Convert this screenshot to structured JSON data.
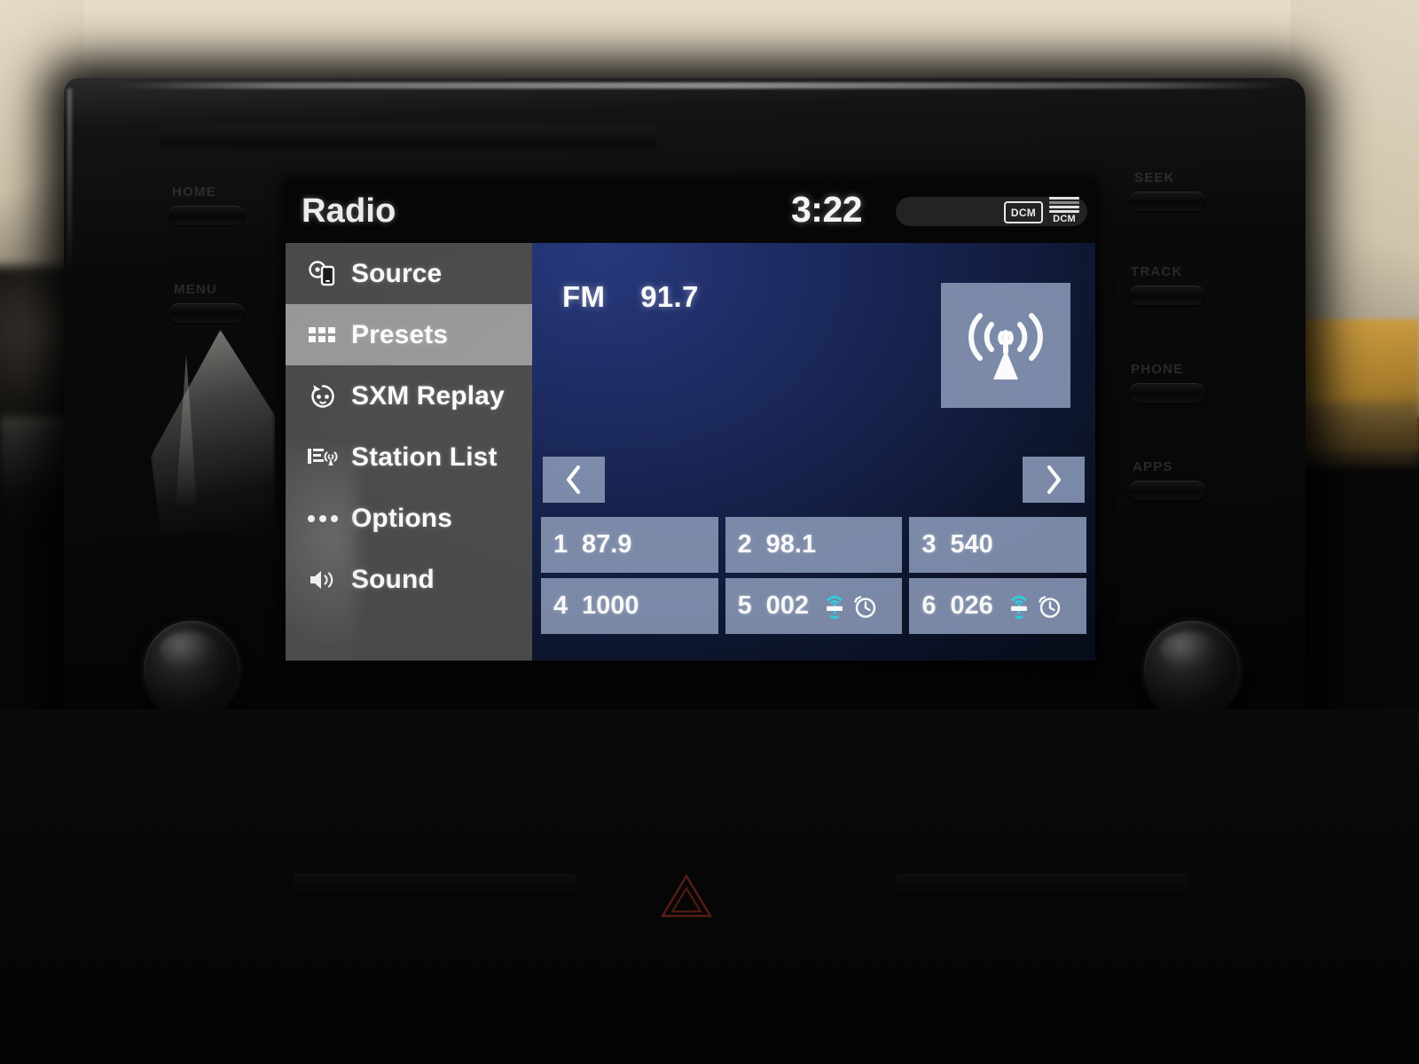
{
  "screen": {
    "title": "Radio",
    "status": {
      "clock": "3:22",
      "dcm_badge": "DCM",
      "signal_label": "DCM"
    }
  },
  "sidebar": {
    "items": [
      {
        "label": "Source",
        "icon": "source-disc-phone-icon",
        "active": false
      },
      {
        "label": "Presets",
        "icon": "presets-grid-icon",
        "active": true
      },
      {
        "label": "SXM Replay",
        "icon": "replay-circle-icon",
        "active": false
      },
      {
        "label": "Station List",
        "icon": "station-list-icon",
        "active": false
      },
      {
        "label": "Options",
        "icon": "ellipsis-icon",
        "active": false
      },
      {
        "label": "Sound",
        "icon": "speaker-icon",
        "active": false
      }
    ]
  },
  "tuner": {
    "band": "FM",
    "frequency": "91.7",
    "artwork_icon": "broadcast-antenna-icon",
    "prev_label": "‹",
    "next_label": "›"
  },
  "presets": [
    {
      "number": "1",
      "value": "87.9",
      "icons": []
    },
    {
      "number": "2",
      "value": "98.1",
      "icons": []
    },
    {
      "number": "3",
      "value": "540",
      "icons": []
    },
    {
      "number": "4",
      "value": "1000",
      "icons": []
    },
    {
      "number": "5",
      "value": "002",
      "icons": [
        "satellite-icon",
        "clock-icon"
      ]
    },
    {
      "number": "6",
      "value": "026",
      "icons": [
        "satellite-icon",
        "clock-icon"
      ]
    }
  ],
  "hardware": {
    "left_buttons": [
      {
        "label": "HOME"
      },
      {
        "label": "MENU"
      }
    ],
    "right_buttons": [
      {
        "label": "SEEK"
      },
      {
        "label": "TRACK"
      },
      {
        "label": "PHONE"
      },
      {
        "label": "APPS"
      }
    ],
    "left_knob": "volume-power-knob",
    "right_knob": "tune-scroll-knob",
    "hazard_button": "hazard-warning-button"
  },
  "colors": {
    "sidebar_bg": "#4c4c4c",
    "sidebar_active": "#9b9b9b",
    "content_blue": "#27397f",
    "tile_blue": "#7d8cab",
    "satellite_cyan": "#2ad7e8",
    "text_white": "#ffffff"
  }
}
